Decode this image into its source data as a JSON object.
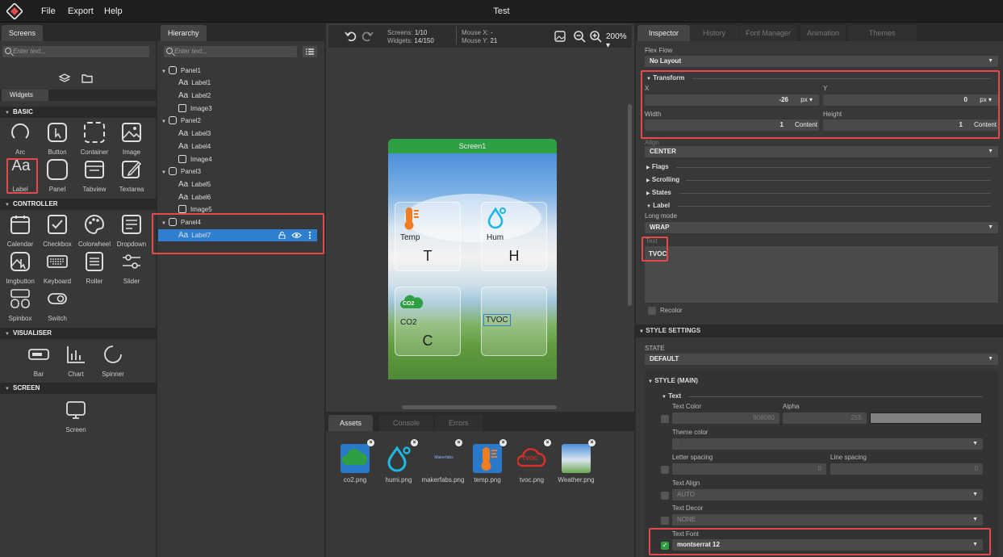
{
  "app": {
    "title": "Test",
    "menu": [
      "File",
      "Export",
      "Help"
    ]
  },
  "left": {
    "tab_screens": "Screens",
    "search_placeholder": "Enter text...",
    "tab_widgets": "Widgets",
    "sections": {
      "basic": "BASIC",
      "controller": "CONTROLLER",
      "visualiser": "VISUALISER",
      "screen": "SCREEN"
    },
    "basic": [
      "Arc",
      "Button",
      "Container",
      "Image",
      "Label",
      "Panel",
      "Tabview",
      "Textarea"
    ],
    "controller": [
      "Calendar",
      "Checkbox",
      "Colorwheel",
      "Dropdown",
      "Imgbutton",
      "Keyboard",
      "Roller",
      "Slider",
      "Spinbox",
      "Switch"
    ],
    "visualiser": [
      "Bar",
      "Chart",
      "Spinner"
    ],
    "screen": [
      "Screen"
    ]
  },
  "hierarchy": {
    "tab": "Hierarchy",
    "search_placeholder": "Enter text...",
    "items": [
      {
        "label": "Panel1",
        "type": "panel"
      },
      {
        "label": "Label1",
        "type": "label"
      },
      {
        "label": "Label2",
        "type": "label"
      },
      {
        "label": "Image3",
        "type": "image"
      },
      {
        "label": "Panel2",
        "type": "panel"
      },
      {
        "label": "Label3",
        "type": "label"
      },
      {
        "label": "Label4",
        "type": "label"
      },
      {
        "label": "Image4",
        "type": "image"
      },
      {
        "label": "Panel3",
        "type": "panel"
      },
      {
        "label": "Label5",
        "type": "label"
      },
      {
        "label": "Label6",
        "type": "label"
      },
      {
        "label": "Image5",
        "type": "image"
      },
      {
        "label": "Panel4",
        "type": "panel"
      },
      {
        "label": "Label7",
        "type": "label",
        "selected": true
      }
    ]
  },
  "canvas": {
    "screens_label": "Screens:",
    "screens_value": "1/10",
    "widgets_label": "Widgets:",
    "widgets_value": "14/150",
    "mousex_label": "Mouse X:",
    "mousex_value": "-",
    "mousey_label": "Mouse Y:",
    "mousey_value": "21",
    "zoom": "200%",
    "screen_title": "Screen1",
    "cards": [
      {
        "label": "Temp",
        "big": "T"
      },
      {
        "label": "Hum",
        "big": "H"
      },
      {
        "label": "CO2",
        "big": "C"
      },
      {
        "label": "TVOC",
        "big": ""
      }
    ],
    "co2_icon_text": "CO2"
  },
  "bottom": {
    "tabs": [
      "Assets",
      "Console",
      "Errors"
    ],
    "assets": [
      "co2.png",
      "humi.png",
      "makerfabs.png",
      "temp.png",
      "tvoc.png",
      "Weather.png"
    ],
    "tvoc_icon_text": "TVOC",
    "makerfabs_icon_text": "Makerfabs"
  },
  "inspector": {
    "tabs": [
      "Inspector",
      "History",
      "Font Manager",
      "Animation",
      "Themes"
    ],
    "flex_flow_label": "Flex Flow",
    "flex_flow_value": "No Layout",
    "transform": "Transform",
    "x_label": "X",
    "x_value": "-26",
    "x_unit": "px",
    "y_label": "Y",
    "y_value": "0",
    "y_unit": "px",
    "width_label": "Width",
    "width_value": "1",
    "width_unit": "Content",
    "height_label": "Height",
    "height_value": "1",
    "height_unit": "Content",
    "align_label": "Align",
    "align_value": "CENTER",
    "flags": "Flags",
    "scrolling": "Scrolling",
    "states": "States",
    "label": "Label",
    "long_mode_label": "Long mode",
    "long_mode_value": "WRAP",
    "text_label": "Text",
    "text_value": "TVOC",
    "recolor": "Recolor",
    "style_settings": "STYLE SETTINGS",
    "state_label": "STATE",
    "state_value": "DEFAULT",
    "style_main": "STYLE (MAIN)",
    "text_group": "Text",
    "text_color_label": "Text Color",
    "text_color_value": "808080",
    "alpha_label": "Alpha",
    "alpha_value": "255",
    "theme_color_label": "Theme color",
    "theme_color_value": "-",
    "letter_spacing_label": "Letter spacing",
    "letter_spacing_value": "0",
    "line_spacing_label": "Line spacing",
    "line_spacing_value": "0",
    "text_align_label": "Text Align",
    "text_align_value": "AUTO",
    "text_decor_label": "Text Decor",
    "text_decor_value": "NONE",
    "text_font_label": "Text Font",
    "text_font_value": "montserrat 12"
  }
}
